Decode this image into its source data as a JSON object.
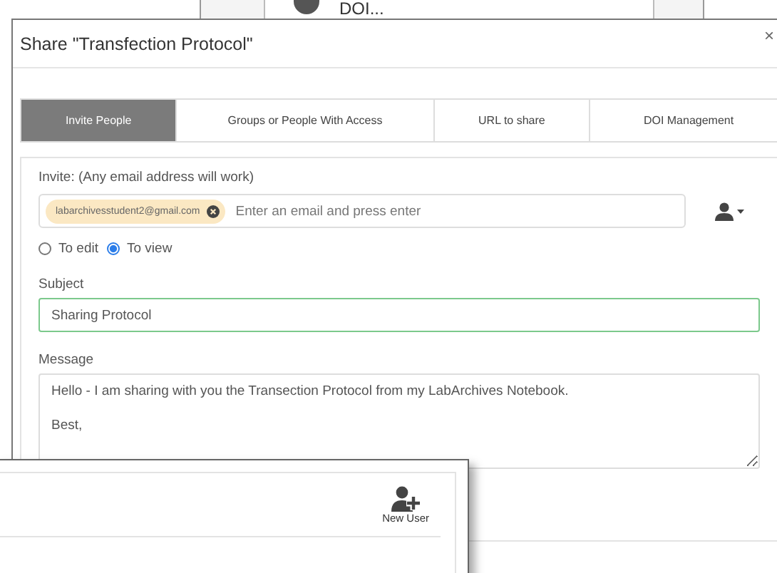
{
  "background_window": {
    "text": "DOI..."
  },
  "dialog": {
    "title": "Share \"Transfection Protocol\"",
    "close": "×"
  },
  "tabs": [
    {
      "label": "Invite People",
      "selected": true
    },
    {
      "label": "Groups or People With Access",
      "selected": false
    },
    {
      "label": "URL to share",
      "selected": false
    },
    {
      "label": "DOI Management",
      "selected": false
    }
  ],
  "invite": {
    "label": "Invite: (Any email address will work)",
    "chips": [
      {
        "text": "labarchivesstudent2@gmail.com"
      }
    ],
    "placeholder": "Enter an email and press enter"
  },
  "permissions": [
    {
      "label": "To edit",
      "selected": false
    },
    {
      "label": "To view",
      "selected": true
    }
  ],
  "subject": {
    "label": "Subject",
    "value": "Sharing Protocol"
  },
  "message": {
    "label": "Message",
    "value": "Hello - I am sharing with you the Transection Protocol from my LabArchives Notebook.\n\nBest,"
  },
  "front_window": {
    "new_user": "New User"
  }
}
